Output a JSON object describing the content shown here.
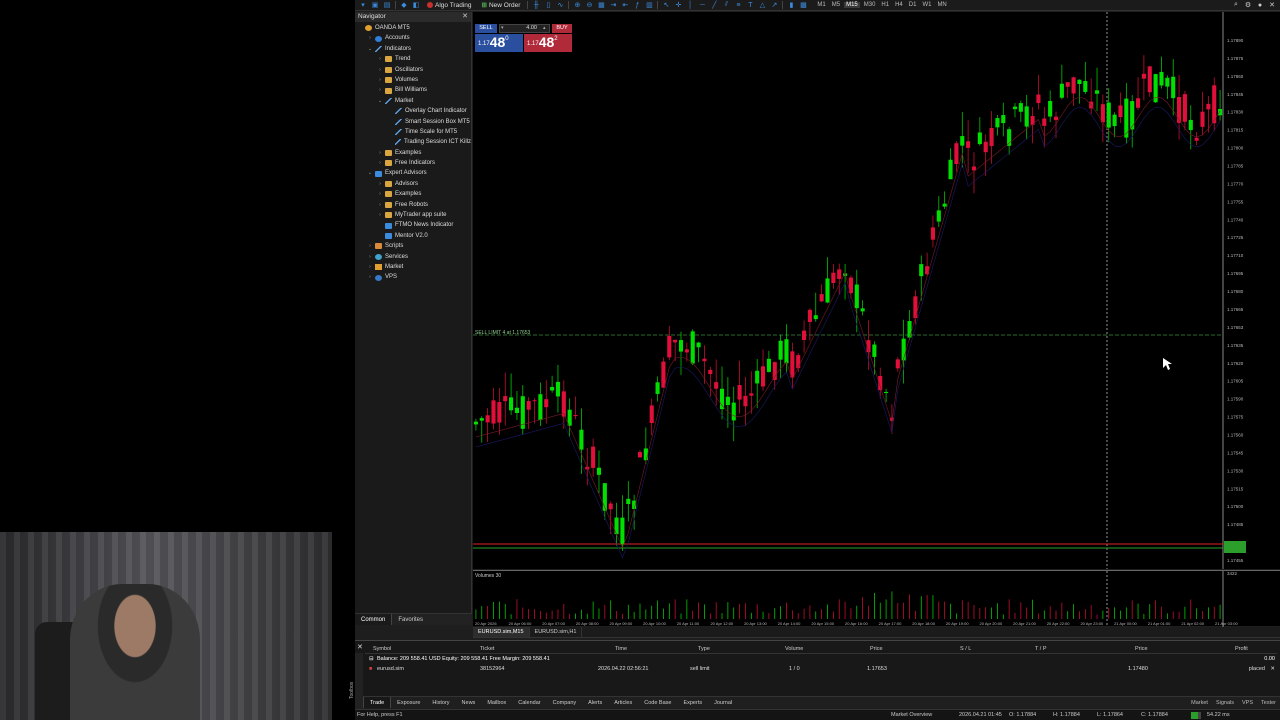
{
  "toolbar": {
    "algo_trading": "Algo Trading",
    "new_order": "New Order",
    "timeframes": [
      "M1",
      "M5",
      "M15",
      "M30",
      "H1",
      "H4",
      "D1",
      "W1",
      "MN"
    ],
    "active_timeframe": "M15"
  },
  "navigator": {
    "title": "Navigator",
    "close": "✕",
    "items": [
      {
        "label": "OANDA MT5",
        "level": 0,
        "arrow": "",
        "icon": "top"
      },
      {
        "label": "Accounts",
        "level": 1,
        "arrow": "›",
        "icon": "blue"
      },
      {
        "label": "Indicators",
        "level": 1,
        "arrow": "⌄",
        "icon": "indic"
      },
      {
        "label": "Trend",
        "level": 2,
        "arrow": "›",
        "icon": "folder"
      },
      {
        "label": "Oscillators",
        "level": 2,
        "arrow": "›",
        "icon": "folder"
      },
      {
        "label": "Volumes",
        "level": 2,
        "arrow": "›",
        "icon": "folder"
      },
      {
        "label": "Bill Williams",
        "level": 2,
        "arrow": "›",
        "icon": "folder"
      },
      {
        "label": "Market",
        "level": 2,
        "arrow": "⌄",
        "icon": "indic"
      },
      {
        "label": "Overlay Chart Indicator",
        "level": 3,
        "arrow": "",
        "icon": "indic"
      },
      {
        "label": "Smart Session Box MT5",
        "level": 3,
        "arrow": "",
        "icon": "indic"
      },
      {
        "label": "Time Scale for MT5",
        "level": 3,
        "arrow": "",
        "icon": "indic"
      },
      {
        "label": "Trading Session ICT Killz",
        "level": 3,
        "arrow": "",
        "icon": "indic"
      },
      {
        "label": "Examples",
        "level": 2,
        "arrow": "›",
        "icon": "folder"
      },
      {
        "label": "Free Indicators",
        "level": 2,
        "arrow": "›",
        "icon": "folder"
      },
      {
        "label": "Expert Advisors",
        "level": 1,
        "arrow": "⌄",
        "icon": "ea"
      },
      {
        "label": "Advisors",
        "level": 2,
        "arrow": "›",
        "icon": "folder"
      },
      {
        "label": "Examples",
        "level": 2,
        "arrow": "›",
        "icon": "folder"
      },
      {
        "label": "Free Robots",
        "level": 2,
        "arrow": "›",
        "icon": "folder"
      },
      {
        "label": "MyTrader app suite",
        "level": 2,
        "arrow": "›",
        "icon": "folder"
      },
      {
        "label": "FTMO News Indicator",
        "level": 2,
        "arrow": "",
        "icon": "ea"
      },
      {
        "label": "Mentor V2.0",
        "level": 2,
        "arrow": "",
        "icon": "ea"
      },
      {
        "label": "Scripts",
        "level": 1,
        "arrow": "›",
        "icon": "script"
      },
      {
        "label": "Services",
        "level": 1,
        "arrow": "›",
        "icon": "svc"
      },
      {
        "label": "Market",
        "level": 1,
        "arrow": "›",
        "icon": "market"
      },
      {
        "label": "VPS",
        "level": 1,
        "arrow": "›",
        "icon": "vps"
      }
    ],
    "tabs": [
      "Common",
      "Favorites"
    ]
  },
  "trade_panel": {
    "sell_label": "SELL",
    "buy_label": "BUY",
    "lot": "4.00",
    "sell_price_small": "1.17",
    "sell_price_big": "48",
    "sell_price_sup": "0",
    "buy_price_small": "1.17",
    "buy_price_big": "48",
    "buy_price_sup": "2"
  },
  "chart": {
    "sell_limit_label": "SELL LIMIT 4 at 1.17653",
    "volumes_label": "Volumes 30",
    "price_labels": [
      "1.17890",
      "1.17875",
      "1.17860",
      "1.17845",
      "1.17830",
      "1.17815",
      "1.17800",
      "1.17785",
      "1.17770",
      "1.17755",
      "1.17740",
      "1.17725",
      "1.17710",
      "1.17695",
      "1.17680",
      "1.17665",
      "1.17653",
      "1.17635",
      "1.17620",
      "1.17605",
      "1.17590",
      "1.17575",
      "1.17560",
      "1.17545",
      "1.17530",
      "1.17515",
      "1.17500",
      "1.17485",
      "1.17470",
      "1.17455"
    ],
    "time_labels": [
      "20 Apr 2026",
      "20 Apr 06:00",
      "20 Apr 07:00",
      "20 Apr 08:00",
      "20 Apr 09:00",
      "20 Apr 10:00",
      "20 Apr 11:00",
      "20 Apr 12:00",
      "20 Apr 13:00",
      "20 Apr 14:00",
      "20 Apr 15:00",
      "20 Apr 16:00",
      "20 Apr 17:00",
      "20 Apr 18:00",
      "20 Apr 19:00",
      "20 Apr 20:00",
      "20 Apr 21:00",
      "20 Apr 22:00",
      "20 Apr 23:00",
      "21 Apr 00:00",
      "21 Apr 01:00",
      "21 Apr 02:00",
      "21 Apr 03:00"
    ],
    "volume_axis_label": "3422",
    "colors": {
      "bull": "#00e000",
      "bear": "#e0103a",
      "sell_limit_line": "#3a8a3a",
      "bid_line": "#e02020",
      "ask_line": "#28a028"
    }
  },
  "chart_tabs": [
    "EURUSD.sim,M15",
    "EURUSD.sim,H1"
  ],
  "toolbox": {
    "close": "✕",
    "side_label": "Toolbox",
    "columns": [
      "Symbol",
      "Ticket",
      "Time",
      "Type",
      "Volume",
      "Price",
      "S / L",
      "T / P",
      "Price",
      "Profit"
    ],
    "balance_line": "Balance: 209 558.41 USD  Equity: 209 558.41  Free Margin: 209 558.41",
    "balance_profit": "0.00",
    "order": {
      "symbol": "eurusd.sim",
      "ticket": "38152964",
      "time": "2026.04.22 02:56:21",
      "type": "sell limit",
      "volume": "1 / 0",
      "price": "1.17653",
      "sl": "",
      "tp": "",
      "cur_price": "1.17480",
      "status": "placed"
    },
    "tabs": [
      "Trade",
      "Exposure",
      "History",
      "News",
      "Mailbox",
      "Calendar",
      "Company",
      "Alerts",
      "Articles",
      "Code Base",
      "Experts",
      "Journal"
    ],
    "right": [
      "Market",
      "Signals",
      "VPS",
      "Tester"
    ]
  },
  "statusbar": {
    "help": "For Help, press F1",
    "profile": "Market Overview",
    "datetime": "2026.04.21 01:45",
    "open": "O: 1.17884",
    "high": "H: 1.17884",
    "low": "L: 1.17864",
    "close": "C: 1.17884",
    "ping": "54.22 ms"
  }
}
